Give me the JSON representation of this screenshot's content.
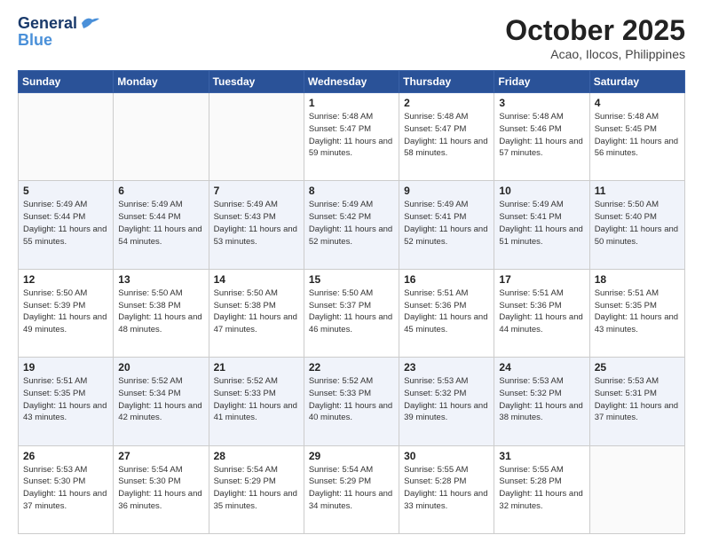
{
  "logo": {
    "line1": "General",
    "line2": "Blue"
  },
  "header": {
    "month": "October 2025",
    "location": "Acao, Ilocos, Philippines"
  },
  "weekdays": [
    "Sunday",
    "Monday",
    "Tuesday",
    "Wednesday",
    "Thursday",
    "Friday",
    "Saturday"
  ],
  "weeks": [
    [
      {
        "day": "",
        "empty": true
      },
      {
        "day": "",
        "empty": true
      },
      {
        "day": "",
        "empty": true
      },
      {
        "day": "1",
        "sunrise": "Sunrise: 5:48 AM",
        "sunset": "Sunset: 5:47 PM",
        "daylight": "Daylight: 11 hours and 59 minutes."
      },
      {
        "day": "2",
        "sunrise": "Sunrise: 5:48 AM",
        "sunset": "Sunset: 5:47 PM",
        "daylight": "Daylight: 11 hours and 58 minutes."
      },
      {
        "day": "3",
        "sunrise": "Sunrise: 5:48 AM",
        "sunset": "Sunset: 5:46 PM",
        "daylight": "Daylight: 11 hours and 57 minutes."
      },
      {
        "day": "4",
        "sunrise": "Sunrise: 5:48 AM",
        "sunset": "Sunset: 5:45 PM",
        "daylight": "Daylight: 11 hours and 56 minutes."
      }
    ],
    [
      {
        "day": "5",
        "sunrise": "Sunrise: 5:49 AM",
        "sunset": "Sunset: 5:44 PM",
        "daylight": "Daylight: 11 hours and 55 minutes."
      },
      {
        "day": "6",
        "sunrise": "Sunrise: 5:49 AM",
        "sunset": "Sunset: 5:44 PM",
        "daylight": "Daylight: 11 hours and 54 minutes."
      },
      {
        "day": "7",
        "sunrise": "Sunrise: 5:49 AM",
        "sunset": "Sunset: 5:43 PM",
        "daylight": "Daylight: 11 hours and 53 minutes."
      },
      {
        "day": "8",
        "sunrise": "Sunrise: 5:49 AM",
        "sunset": "Sunset: 5:42 PM",
        "daylight": "Daylight: 11 hours and 52 minutes."
      },
      {
        "day": "9",
        "sunrise": "Sunrise: 5:49 AM",
        "sunset": "Sunset: 5:41 PM",
        "daylight": "Daylight: 11 hours and 52 minutes."
      },
      {
        "day": "10",
        "sunrise": "Sunrise: 5:49 AM",
        "sunset": "Sunset: 5:41 PM",
        "daylight": "Daylight: 11 hours and 51 minutes."
      },
      {
        "day": "11",
        "sunrise": "Sunrise: 5:50 AM",
        "sunset": "Sunset: 5:40 PM",
        "daylight": "Daylight: 11 hours and 50 minutes."
      }
    ],
    [
      {
        "day": "12",
        "sunrise": "Sunrise: 5:50 AM",
        "sunset": "Sunset: 5:39 PM",
        "daylight": "Daylight: 11 hours and 49 minutes."
      },
      {
        "day": "13",
        "sunrise": "Sunrise: 5:50 AM",
        "sunset": "Sunset: 5:38 PM",
        "daylight": "Daylight: 11 hours and 48 minutes."
      },
      {
        "day": "14",
        "sunrise": "Sunrise: 5:50 AM",
        "sunset": "Sunset: 5:38 PM",
        "daylight": "Daylight: 11 hours and 47 minutes."
      },
      {
        "day": "15",
        "sunrise": "Sunrise: 5:50 AM",
        "sunset": "Sunset: 5:37 PM",
        "daylight": "Daylight: 11 hours and 46 minutes."
      },
      {
        "day": "16",
        "sunrise": "Sunrise: 5:51 AM",
        "sunset": "Sunset: 5:36 PM",
        "daylight": "Daylight: 11 hours and 45 minutes."
      },
      {
        "day": "17",
        "sunrise": "Sunrise: 5:51 AM",
        "sunset": "Sunset: 5:36 PM",
        "daylight": "Daylight: 11 hours and 44 minutes."
      },
      {
        "day": "18",
        "sunrise": "Sunrise: 5:51 AM",
        "sunset": "Sunset: 5:35 PM",
        "daylight": "Daylight: 11 hours and 43 minutes."
      }
    ],
    [
      {
        "day": "19",
        "sunrise": "Sunrise: 5:51 AM",
        "sunset": "Sunset: 5:35 PM",
        "daylight": "Daylight: 11 hours and 43 minutes."
      },
      {
        "day": "20",
        "sunrise": "Sunrise: 5:52 AM",
        "sunset": "Sunset: 5:34 PM",
        "daylight": "Daylight: 11 hours and 42 minutes."
      },
      {
        "day": "21",
        "sunrise": "Sunrise: 5:52 AM",
        "sunset": "Sunset: 5:33 PM",
        "daylight": "Daylight: 11 hours and 41 minutes."
      },
      {
        "day": "22",
        "sunrise": "Sunrise: 5:52 AM",
        "sunset": "Sunset: 5:33 PM",
        "daylight": "Daylight: 11 hours and 40 minutes."
      },
      {
        "day": "23",
        "sunrise": "Sunrise: 5:53 AM",
        "sunset": "Sunset: 5:32 PM",
        "daylight": "Daylight: 11 hours and 39 minutes."
      },
      {
        "day": "24",
        "sunrise": "Sunrise: 5:53 AM",
        "sunset": "Sunset: 5:32 PM",
        "daylight": "Daylight: 11 hours and 38 minutes."
      },
      {
        "day": "25",
        "sunrise": "Sunrise: 5:53 AM",
        "sunset": "Sunset: 5:31 PM",
        "daylight": "Daylight: 11 hours and 37 minutes."
      }
    ],
    [
      {
        "day": "26",
        "sunrise": "Sunrise: 5:53 AM",
        "sunset": "Sunset: 5:30 PM",
        "daylight": "Daylight: 11 hours and 37 minutes."
      },
      {
        "day": "27",
        "sunrise": "Sunrise: 5:54 AM",
        "sunset": "Sunset: 5:30 PM",
        "daylight": "Daylight: 11 hours and 36 minutes."
      },
      {
        "day": "28",
        "sunrise": "Sunrise: 5:54 AM",
        "sunset": "Sunset: 5:29 PM",
        "daylight": "Daylight: 11 hours and 35 minutes."
      },
      {
        "day": "29",
        "sunrise": "Sunrise: 5:54 AM",
        "sunset": "Sunset: 5:29 PM",
        "daylight": "Daylight: 11 hours and 34 minutes."
      },
      {
        "day": "30",
        "sunrise": "Sunrise: 5:55 AM",
        "sunset": "Sunset: 5:28 PM",
        "daylight": "Daylight: 11 hours and 33 minutes."
      },
      {
        "day": "31",
        "sunrise": "Sunrise: 5:55 AM",
        "sunset": "Sunset: 5:28 PM",
        "daylight": "Daylight: 11 hours and 32 minutes."
      },
      {
        "day": "",
        "empty": true
      }
    ]
  ]
}
